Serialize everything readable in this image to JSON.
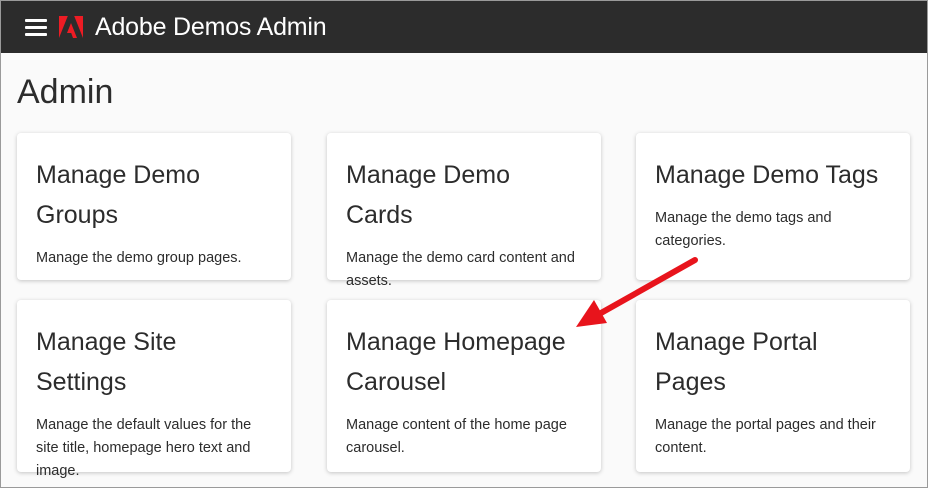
{
  "header": {
    "title": "Adobe Demos Admin",
    "menu_icon": "hamburger-menu-icon",
    "logo_icon": "adobe-logo-icon",
    "background": "#2c2c2c",
    "logo_color": "#ed1c24"
  },
  "page": {
    "title": "Admin"
  },
  "cards": [
    {
      "title": "Manage Demo Groups",
      "description": "Manage the demo group pages."
    },
    {
      "title": "Manage Demo Cards",
      "description": "Manage the demo card content and assets."
    },
    {
      "title": "Manage Demo Tags",
      "description": "Manage the demo tags and categories."
    },
    {
      "title": "Manage Site Settings",
      "description": "Manage the default values for the site title, homepage hero text and image."
    },
    {
      "title": "Manage Homepage Carousel",
      "description": "Manage content of the home page carousel."
    },
    {
      "title": "Manage Portal Pages",
      "description": "Manage the portal pages and their content."
    }
  ],
  "annotation": {
    "arrow_color": "#e8141c",
    "points_to": "Manage Homepage Carousel"
  }
}
